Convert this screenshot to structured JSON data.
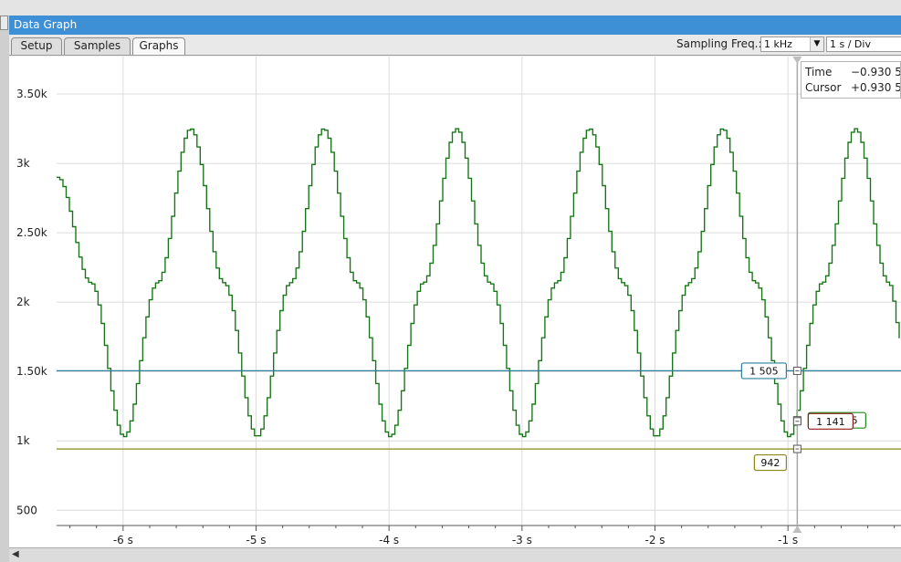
{
  "window": {
    "title": "Data Graph"
  },
  "tabs": [
    {
      "label": "Setup",
      "active": false
    },
    {
      "label": "Samples",
      "active": false
    },
    {
      "label": "Graphs",
      "active": true
    }
  ],
  "toolbar": {
    "sampling_freq_label": "Sampling Freq.:",
    "sampling_freq_value": "1 kHz",
    "time_div_value": "1 s / Div"
  },
  "readout": {
    "time_label": "Time",
    "time_value": "−0.930 5",
    "cursor_label": "Cursor",
    "cursor_value": "+0.930 5"
  },
  "chart_data": {
    "type": "line",
    "xlim": [
      -6.5,
      -0.15
    ],
    "ylim": [
      390,
      3770
    ],
    "grid": true,
    "y_ticks": [
      500,
      1000,
      1500,
      2000,
      2500,
      3000,
      3500
    ],
    "y_tick_labels": [
      "500",
      "1k",
      "1.50k",
      "2k",
      "2.50k",
      "3k",
      "3.50k"
    ],
    "x_ticks": [
      -6,
      -5,
      -4,
      -3,
      -2,
      -1
    ],
    "x_tick_labels": [
      "-6 s",
      "-5 s",
      "-4 s",
      "-3 s",
      "-2 s",
      "-1 s"
    ],
    "cursor_x": -0.93,
    "series": [
      {
        "color": "#1f8a1f",
        "style": "stepped sine",
        "x": [
          -6.5,
          -6.25,
          -6.0,
          -5.75,
          -5.5,
          -5.25,
          -5.0,
          -4.75,
          -4.5,
          -4.25,
          -4.0,
          -3.75,
          -3.5,
          -3.25,
          -3.0,
          -2.75,
          -2.5,
          -2.25,
          -2.0,
          -1.75,
          -1.5,
          -1.25,
          -1.0,
          -0.75,
          -0.5,
          -0.25,
          -0.15
        ],
        "y": [
          2900,
          2140,
          1030,
          2140,
          3250,
          2140,
          1030,
          2140,
          3250,
          2140,
          1030,
          2140,
          3250,
          2140,
          1030,
          2140,
          3250,
          2140,
          1030,
          2140,
          3250,
          2140,
          1030,
          2140,
          3250,
          2140,
          1720
        ],
        "cursor_label": "1148.35",
        "cursor_value": 1148.35
      },
      {
        "color": "#2b7f9f",
        "x": [
          -6.5,
          -0.15
        ],
        "y": [
          1505,
          1505
        ],
        "cursor_label": "1 505",
        "cursor_value": 1505
      },
      {
        "color": "#8a8a1a",
        "x": [
          -6.5,
          -0.15
        ],
        "y": [
          942,
          942
        ],
        "cursor_label": "942",
        "cursor_value": 942
      },
      {
        "color": "#8f1b1b",
        "cursor_label": "1 141",
        "cursor_value": 1141
      }
    ]
  }
}
